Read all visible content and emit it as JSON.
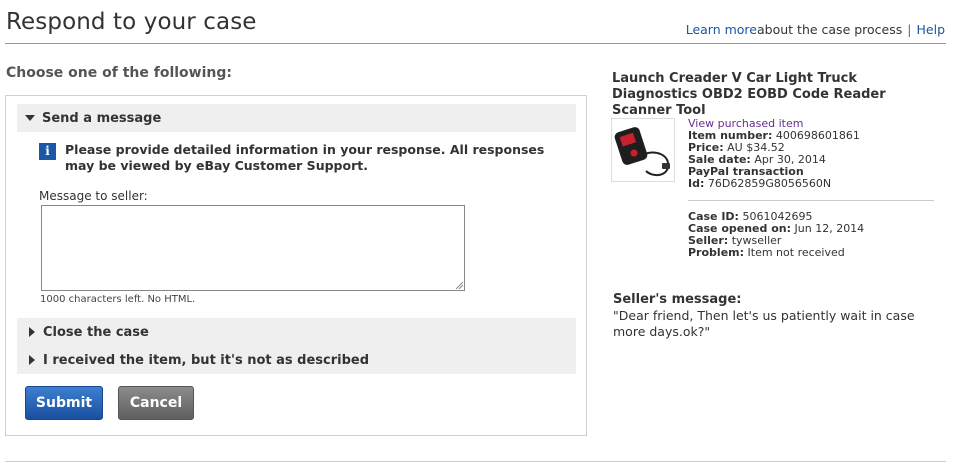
{
  "header": {
    "title": "Respond to your case",
    "learn_more": "Learn more",
    "learn_more_suffix": "about the case process",
    "separator": "|",
    "help": "Help"
  },
  "form": {
    "heading": "Choose one of the following:",
    "send_message": {
      "label": "Send a message",
      "info_icon": "info-icon",
      "info_text": "Please provide detailed information in your response. All responses may be viewed by eBay Customer Support.",
      "message_label": "Message to seller:",
      "message_value": "",
      "chars_left": "1000 characters left. No HTML."
    },
    "close_case_label": "Close the case",
    "not_as_described_label": "I received the item, but it's not as described",
    "submit_label": "Submit",
    "cancel_label": "Cancel"
  },
  "item": {
    "title": "Launch Creader V Car Light Truck Diagnostics OBD2 EOBD Code Reader Scanner Tool",
    "view_purchased": "View purchased item",
    "item_number_label": "Item number:",
    "item_number": "400698601861",
    "price_label": "Price:",
    "price": "AU $34.52",
    "sale_date_label": "Sale date:",
    "sale_date": "Apr 30, 2014",
    "paypal_label": "PayPal transaction",
    "id_label": "Id:",
    "id": "76D62859G8056560N"
  },
  "case": {
    "case_id_label": "Case ID:",
    "case_id": "5061042695",
    "opened_label": "Case opened on:",
    "opened": "Jun 12, 2014",
    "seller_label": "Seller:",
    "seller": "tywseller",
    "problem_label": "Problem:",
    "problem": "Item not received"
  },
  "seller_message": {
    "title": "Seller's message:",
    "text": "\"Dear friend, Then let's us patiently wait in case more days.ok?\""
  },
  "colors": {
    "link": "#1a57a5",
    "visited_link": "#6a2c91",
    "submit": "#1a4f9f",
    "cancel": "#5f5f5f"
  }
}
